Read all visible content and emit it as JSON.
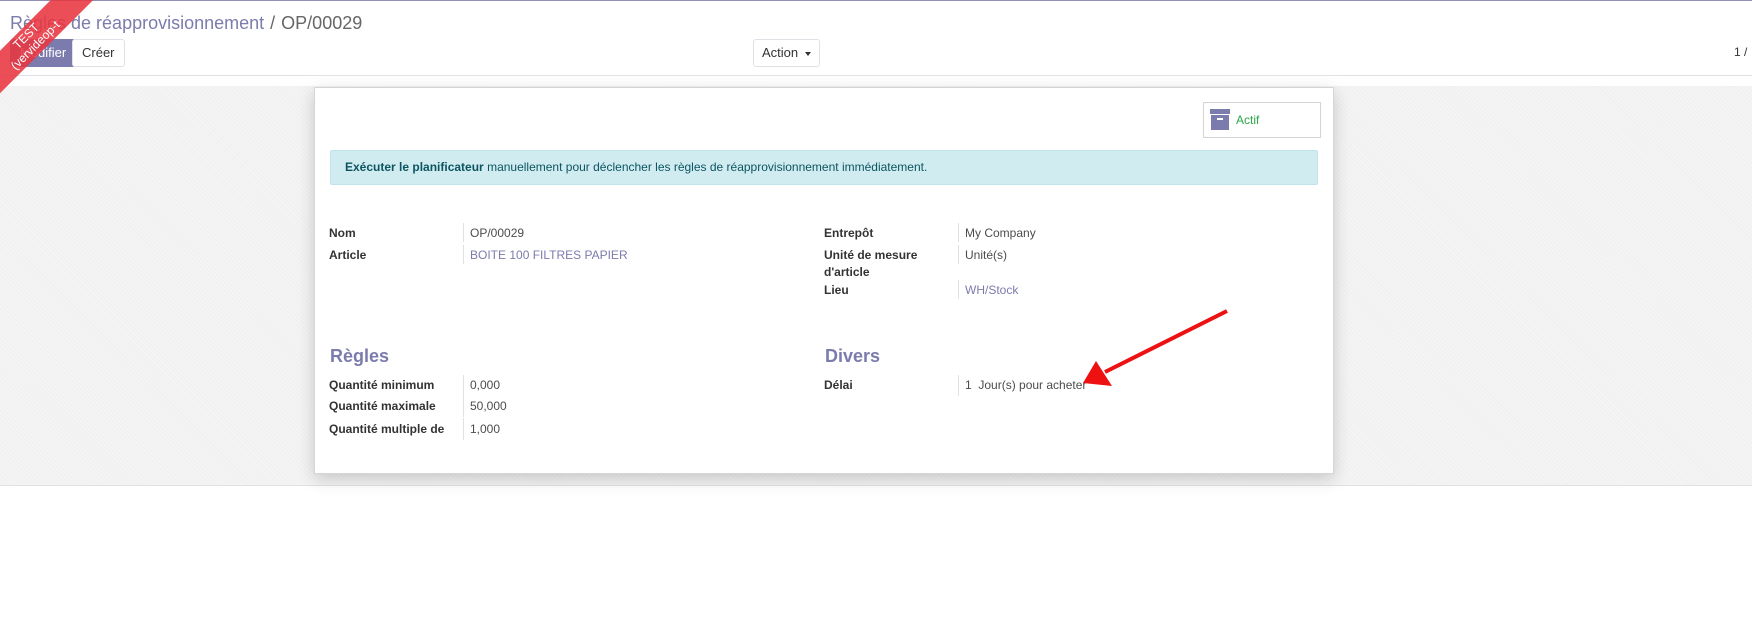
{
  "ribbon": {
    "line1": "TEST",
    "line2": "(vervideop-t"
  },
  "breadcrumb": {
    "parent": "Règles de réapprovisionnement",
    "separator": "/",
    "current": "OP/00029"
  },
  "toolbar": {
    "edit_label": "Modifier",
    "create_label": "Créer",
    "action_label": "Action"
  },
  "pager": {
    "text": "1 /"
  },
  "sheet": {
    "stat_button": {
      "label": "Actif",
      "icon": "archive-icon"
    },
    "alert": {
      "strong": "Exécuter le planificateur",
      "text": " manuellement pour déclencher les règles de réapprovisionnement immédiatement."
    },
    "fields_left": {
      "name_label": "Nom",
      "name_value": "OP/00029",
      "product_label": "Article",
      "product_value": "BOITE 100 FILTRES PAPIER"
    },
    "fields_right": {
      "warehouse_label": "Entrepôt",
      "warehouse_value": "My Company",
      "uom_label_1": "Unité de mesure",
      "uom_label_2": "d'article",
      "uom_value": "Unité(s)",
      "location_label": "Lieu",
      "location_value": "WH/Stock"
    },
    "rules": {
      "title": "Règles",
      "min_label": "Quantité minimum",
      "min_value": "0,000",
      "max_label": "Quantité maximale",
      "max_value": "50,000",
      "multiple_label": "Quantité multiple de",
      "multiple_value": "1,000"
    },
    "misc": {
      "title": "Divers",
      "lead_label": "Délai",
      "lead_days": "1",
      "lead_unit": "Jour(s) pour acheter"
    }
  },
  "annotation": {
    "color": "#ee1111"
  }
}
